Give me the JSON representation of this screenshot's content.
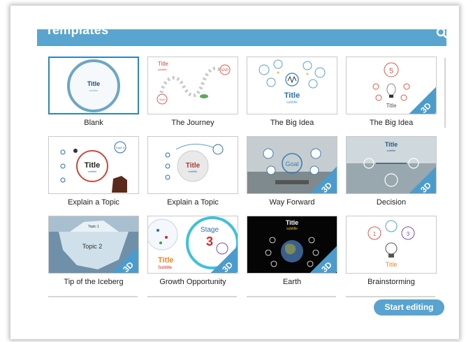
{
  "header": {
    "title": "Templates"
  },
  "templates": [
    {
      "label": "Blank"
    },
    {
      "label": "The Journey"
    },
    {
      "label": "The Big Idea"
    },
    {
      "label": "The Big Idea",
      "badge": "3D"
    },
    {
      "label": "Explain a Topic"
    },
    {
      "label": "Explain a Topic"
    },
    {
      "label": "Way Forward",
      "badge": "3D"
    },
    {
      "label": "Decision",
      "badge": "3D"
    },
    {
      "label": "Tip of the Iceberg",
      "badge": "3D"
    },
    {
      "label": "Growth Opportunity",
      "badge": "3D"
    },
    {
      "label": "Earth",
      "badge": "3D"
    },
    {
      "label": "Brainstorming"
    }
  ],
  "thumb_text": {
    "blank_title": "Title",
    "blank_sub": "subtitle",
    "journey_title": "Title",
    "journey_sub": "subtitle",
    "journey_end": "END",
    "journey_start": "Start",
    "bigidea_title": "Title",
    "bigidea_sub": "subtitle",
    "bigidea3d_num": "5",
    "bigidea3d_title": "Title",
    "explain_title": "Title",
    "explain_sub": "subtitle",
    "explain_topic": "Topic 4",
    "explain2_title": "Title",
    "explain2_sub": "subtitle",
    "goal": "Goal",
    "decision_title": "Title",
    "decision_sub": "subtitle",
    "iceberg_topic1": "Topic 1",
    "iceberg_topic2": "Topic 2",
    "growth_title": "Title",
    "growth_sub": "Subtitle",
    "growth_stage": "Stage",
    "growth_num": "3",
    "earth_title": "Title",
    "earth_sub": "subtitle",
    "brain_title": "Title"
  },
  "actions": {
    "start_editing": "Start editing"
  }
}
